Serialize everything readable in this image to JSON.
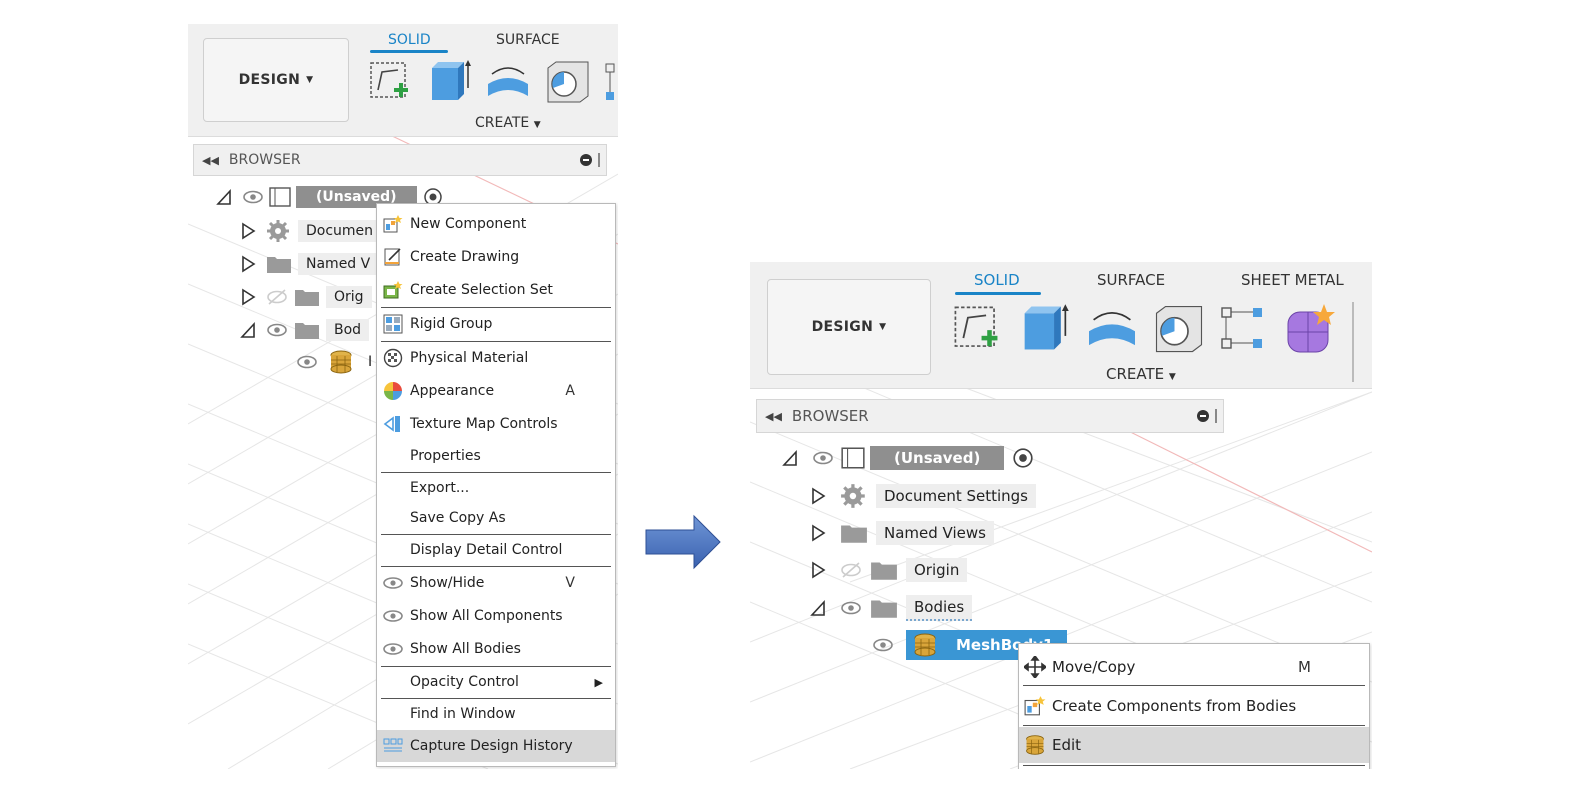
{
  "left": {
    "design_label": "DESIGN",
    "tabs": [
      "SOLID",
      "SURFACE"
    ],
    "create_label": "CREATE",
    "browser_label": "BROWSER",
    "tree": [
      {
        "label": "(Unsaved)"
      },
      {
        "label": "Documen"
      },
      {
        "label": "Named V"
      },
      {
        "label": "Orig"
      },
      {
        "label": "Bod"
      },
      {
        "label": "I"
      }
    ],
    "menu": [
      {
        "label": "New Component",
        "icon": "new-component-icon",
        "shortcut": ""
      },
      {
        "label": "Create Drawing",
        "icon": "create-drawing-icon",
        "shortcut": ""
      },
      {
        "label": "Create Selection Set",
        "icon": "selection-set-icon",
        "shortcut": ""
      },
      {
        "label": "Rigid Group",
        "icon": "rigid-group-icon",
        "shortcut": ""
      },
      {
        "label": "Physical Material",
        "icon": "physical-material-icon",
        "shortcut": ""
      },
      {
        "label": "Appearance",
        "icon": "appearance-icon",
        "shortcut": "A"
      },
      {
        "label": "Texture Map Controls",
        "icon": "texture-map-icon",
        "shortcut": ""
      },
      {
        "label": "Properties",
        "icon": "",
        "shortcut": ""
      },
      {
        "label": "Export...",
        "icon": "",
        "shortcut": ""
      },
      {
        "label": "Save Copy As",
        "icon": "",
        "shortcut": ""
      },
      {
        "label": "Display Detail Control",
        "icon": "",
        "shortcut": ""
      },
      {
        "label": "Show/Hide",
        "icon": "eye-icon",
        "shortcut": "V"
      },
      {
        "label": "Show All Components",
        "icon": "eye-icon",
        "shortcut": ""
      },
      {
        "label": "Show All Bodies",
        "icon": "eye-icon",
        "shortcut": ""
      },
      {
        "label": "Opacity Control",
        "icon": "",
        "shortcut": ""
      },
      {
        "label": "Find in Window",
        "icon": "",
        "shortcut": ""
      },
      {
        "label": "Capture Design History",
        "icon": "capture-history-icon",
        "shortcut": ""
      }
    ]
  },
  "right": {
    "design_label": "DESIGN",
    "tabs": [
      "SOLID",
      "SURFACE",
      "SHEET METAL"
    ],
    "create_label": "CREATE",
    "browser_label": "BROWSER",
    "tree": [
      {
        "label": "(Unsaved)"
      },
      {
        "label": "Document Settings"
      },
      {
        "label": "Named Views"
      },
      {
        "label": "Origin"
      },
      {
        "label": "Bodies"
      },
      {
        "label": "MeshBody1"
      }
    ],
    "menu": [
      {
        "label": "Move/Copy",
        "icon": "move-icon",
        "shortcut": "M"
      },
      {
        "label": "Create Components from Bodies",
        "icon": "new-component-icon",
        "shortcut": ""
      },
      {
        "label": "Edit",
        "icon": "mesh-body-icon",
        "shortcut": ""
      }
    ]
  },
  "colors": {
    "accent": "#1a84c7",
    "selection": "#3a96d4",
    "arrow": "#3f6fc2"
  }
}
